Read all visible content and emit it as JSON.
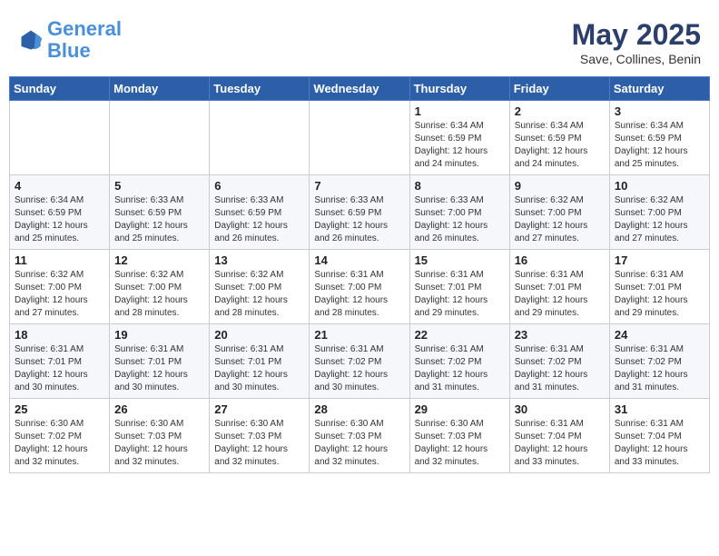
{
  "header": {
    "logo_general": "General",
    "logo_blue": "Blue",
    "month_title": "May 2025",
    "location": "Save, Collines, Benin"
  },
  "weekdays": [
    "Sunday",
    "Monday",
    "Tuesday",
    "Wednesday",
    "Thursday",
    "Friday",
    "Saturday"
  ],
  "weeks": [
    [
      {
        "day": "",
        "info": ""
      },
      {
        "day": "",
        "info": ""
      },
      {
        "day": "",
        "info": ""
      },
      {
        "day": "",
        "info": ""
      },
      {
        "day": "1",
        "info": "Sunrise: 6:34 AM\nSunset: 6:59 PM\nDaylight: 12 hours\nand 24 minutes."
      },
      {
        "day": "2",
        "info": "Sunrise: 6:34 AM\nSunset: 6:59 PM\nDaylight: 12 hours\nand 24 minutes."
      },
      {
        "day": "3",
        "info": "Sunrise: 6:34 AM\nSunset: 6:59 PM\nDaylight: 12 hours\nand 25 minutes."
      }
    ],
    [
      {
        "day": "4",
        "info": "Sunrise: 6:34 AM\nSunset: 6:59 PM\nDaylight: 12 hours\nand 25 minutes."
      },
      {
        "day": "5",
        "info": "Sunrise: 6:33 AM\nSunset: 6:59 PM\nDaylight: 12 hours\nand 25 minutes."
      },
      {
        "day": "6",
        "info": "Sunrise: 6:33 AM\nSunset: 6:59 PM\nDaylight: 12 hours\nand 26 minutes."
      },
      {
        "day": "7",
        "info": "Sunrise: 6:33 AM\nSunset: 6:59 PM\nDaylight: 12 hours\nand 26 minutes."
      },
      {
        "day": "8",
        "info": "Sunrise: 6:33 AM\nSunset: 7:00 PM\nDaylight: 12 hours\nand 26 minutes."
      },
      {
        "day": "9",
        "info": "Sunrise: 6:32 AM\nSunset: 7:00 PM\nDaylight: 12 hours\nand 27 minutes."
      },
      {
        "day": "10",
        "info": "Sunrise: 6:32 AM\nSunset: 7:00 PM\nDaylight: 12 hours\nand 27 minutes."
      }
    ],
    [
      {
        "day": "11",
        "info": "Sunrise: 6:32 AM\nSunset: 7:00 PM\nDaylight: 12 hours\nand 27 minutes."
      },
      {
        "day": "12",
        "info": "Sunrise: 6:32 AM\nSunset: 7:00 PM\nDaylight: 12 hours\nand 28 minutes."
      },
      {
        "day": "13",
        "info": "Sunrise: 6:32 AM\nSunset: 7:00 PM\nDaylight: 12 hours\nand 28 minutes."
      },
      {
        "day": "14",
        "info": "Sunrise: 6:31 AM\nSunset: 7:00 PM\nDaylight: 12 hours\nand 28 minutes."
      },
      {
        "day": "15",
        "info": "Sunrise: 6:31 AM\nSunset: 7:01 PM\nDaylight: 12 hours\nand 29 minutes."
      },
      {
        "day": "16",
        "info": "Sunrise: 6:31 AM\nSunset: 7:01 PM\nDaylight: 12 hours\nand 29 minutes."
      },
      {
        "day": "17",
        "info": "Sunrise: 6:31 AM\nSunset: 7:01 PM\nDaylight: 12 hours\nand 29 minutes."
      }
    ],
    [
      {
        "day": "18",
        "info": "Sunrise: 6:31 AM\nSunset: 7:01 PM\nDaylight: 12 hours\nand 30 minutes."
      },
      {
        "day": "19",
        "info": "Sunrise: 6:31 AM\nSunset: 7:01 PM\nDaylight: 12 hours\nand 30 minutes."
      },
      {
        "day": "20",
        "info": "Sunrise: 6:31 AM\nSunset: 7:01 PM\nDaylight: 12 hours\nand 30 minutes."
      },
      {
        "day": "21",
        "info": "Sunrise: 6:31 AM\nSunset: 7:02 PM\nDaylight: 12 hours\nand 30 minutes."
      },
      {
        "day": "22",
        "info": "Sunrise: 6:31 AM\nSunset: 7:02 PM\nDaylight: 12 hours\nand 31 minutes."
      },
      {
        "day": "23",
        "info": "Sunrise: 6:31 AM\nSunset: 7:02 PM\nDaylight: 12 hours\nand 31 minutes."
      },
      {
        "day": "24",
        "info": "Sunrise: 6:31 AM\nSunset: 7:02 PM\nDaylight: 12 hours\nand 31 minutes."
      }
    ],
    [
      {
        "day": "25",
        "info": "Sunrise: 6:30 AM\nSunset: 7:02 PM\nDaylight: 12 hours\nand 32 minutes."
      },
      {
        "day": "26",
        "info": "Sunrise: 6:30 AM\nSunset: 7:03 PM\nDaylight: 12 hours\nand 32 minutes."
      },
      {
        "day": "27",
        "info": "Sunrise: 6:30 AM\nSunset: 7:03 PM\nDaylight: 12 hours\nand 32 minutes."
      },
      {
        "day": "28",
        "info": "Sunrise: 6:30 AM\nSunset: 7:03 PM\nDaylight: 12 hours\nand 32 minutes."
      },
      {
        "day": "29",
        "info": "Sunrise: 6:30 AM\nSunset: 7:03 PM\nDaylight: 12 hours\nand 32 minutes."
      },
      {
        "day": "30",
        "info": "Sunrise: 6:31 AM\nSunset: 7:04 PM\nDaylight: 12 hours\nand 33 minutes."
      },
      {
        "day": "31",
        "info": "Sunrise: 6:31 AM\nSunset: 7:04 PM\nDaylight: 12 hours\nand 33 minutes."
      }
    ]
  ]
}
